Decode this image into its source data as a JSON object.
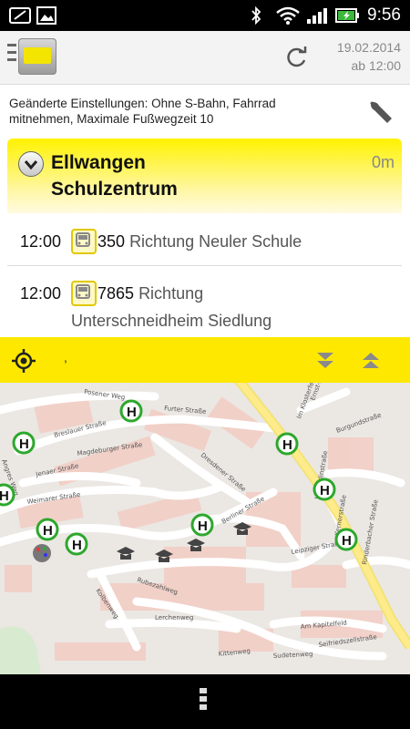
{
  "status_bar": {
    "time": "9:56"
  },
  "header": {
    "date": "19.02.2014",
    "time_label": "ab 12:00"
  },
  "settings_text": "Geänderte Einstellungen: Ohne S-Bahn, Fahrrad mitnehmen, Maximale Fußwegzeit 10",
  "stop": {
    "name_line1": "Ellwangen",
    "name_line2": "Schulzentrum",
    "distance": "0m"
  },
  "departures": [
    {
      "time": "12:00",
      "line": "350",
      "direction": "Richtung Neuler Schule"
    },
    {
      "time": "12:00",
      "line": "7865",
      "direction": "Richtung",
      "direction_line2": "Unterschneidheim Siedlung"
    }
  ],
  "map_toolbar": {
    "location_text": ","
  },
  "map": {
    "street_labels": [
      "Posener Weg",
      "Breslauer Straße",
      "Magdeburger Straße",
      "Jenaer Straße",
      "Weimarer Straße",
      "Furter Straße",
      "Dresdener Straße",
      "Berliner Straße",
      "Leipziger Straße",
      "Holderlinstraße",
      "Kernerstraße",
      "Burgundstraße",
      "Rinderbacher Straße",
      "Kolbenweg",
      "Rubezahlweg",
      "Lerchenweg",
      "Am Kapitelfeld",
      "Seifriedszellstraße",
      "Im Klosterfeld",
      "Ernst-Bacher-Straße",
      "Kittenweg",
      "Sudetenweg",
      "Angres Weg"
    ],
    "stop_symbol": "H"
  },
  "colors": {
    "accent": "#ffe800",
    "stop_ring": "#2da82d"
  }
}
